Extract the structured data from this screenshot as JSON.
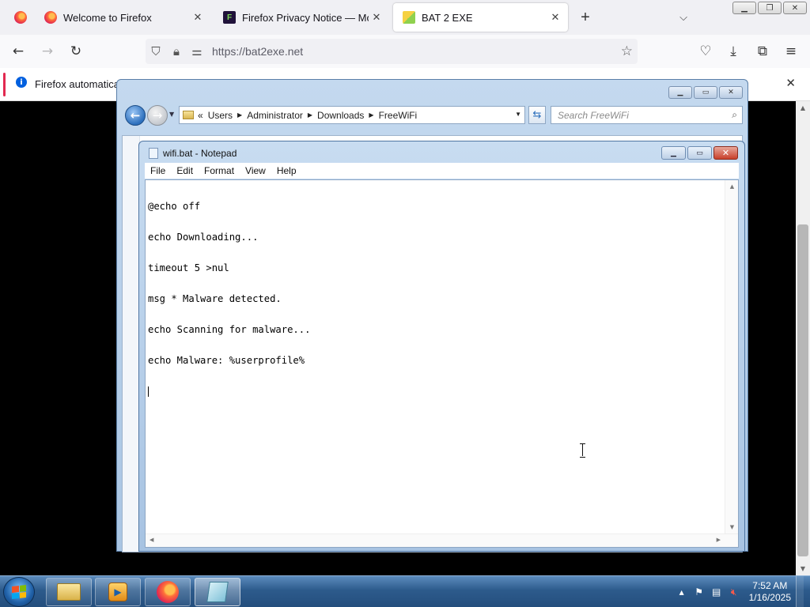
{
  "browser": {
    "tabs": [
      {
        "title": "Welcome to Firefox",
        "icon": "firefox-icon",
        "active": false
      },
      {
        "title": "Firefox Privacy Notice — Mozill",
        "icon": "privacy-notice-icon",
        "active": false
      },
      {
        "title": "BAT 2 EXE",
        "icon": "bat2exe-favicon",
        "active": true
      }
    ],
    "url": "https://bat2exe.net",
    "notice": "Firefox automaticall"
  },
  "explorer": {
    "breadcrumbs": [
      "Users",
      "Administrator",
      "Downloads",
      "FreeWiFi"
    ],
    "breadcrumb_lead": "«",
    "search_placeholder": "Search FreeWiFi"
  },
  "notepad": {
    "title": "wifi.bat - Notepad",
    "menu": [
      "File",
      "Edit",
      "Format",
      "View",
      "Help"
    ],
    "lines": [
      "@echo off",
      "echo Downloading...",
      "timeout 5 >nul",
      "msg * Malware detected.",
      "echo Scanning for malware...",
      "echo Malware: %userprofile%"
    ]
  },
  "taskbar": {
    "clock_time": "7:52 AM",
    "clock_date": "1/16/2025",
    "apps": [
      "windows-explorer",
      "media-player",
      "firefox",
      "notepad"
    ]
  },
  "colors": {
    "notice_accent": "#e22850",
    "taskbar": "#2d5b8c"
  }
}
